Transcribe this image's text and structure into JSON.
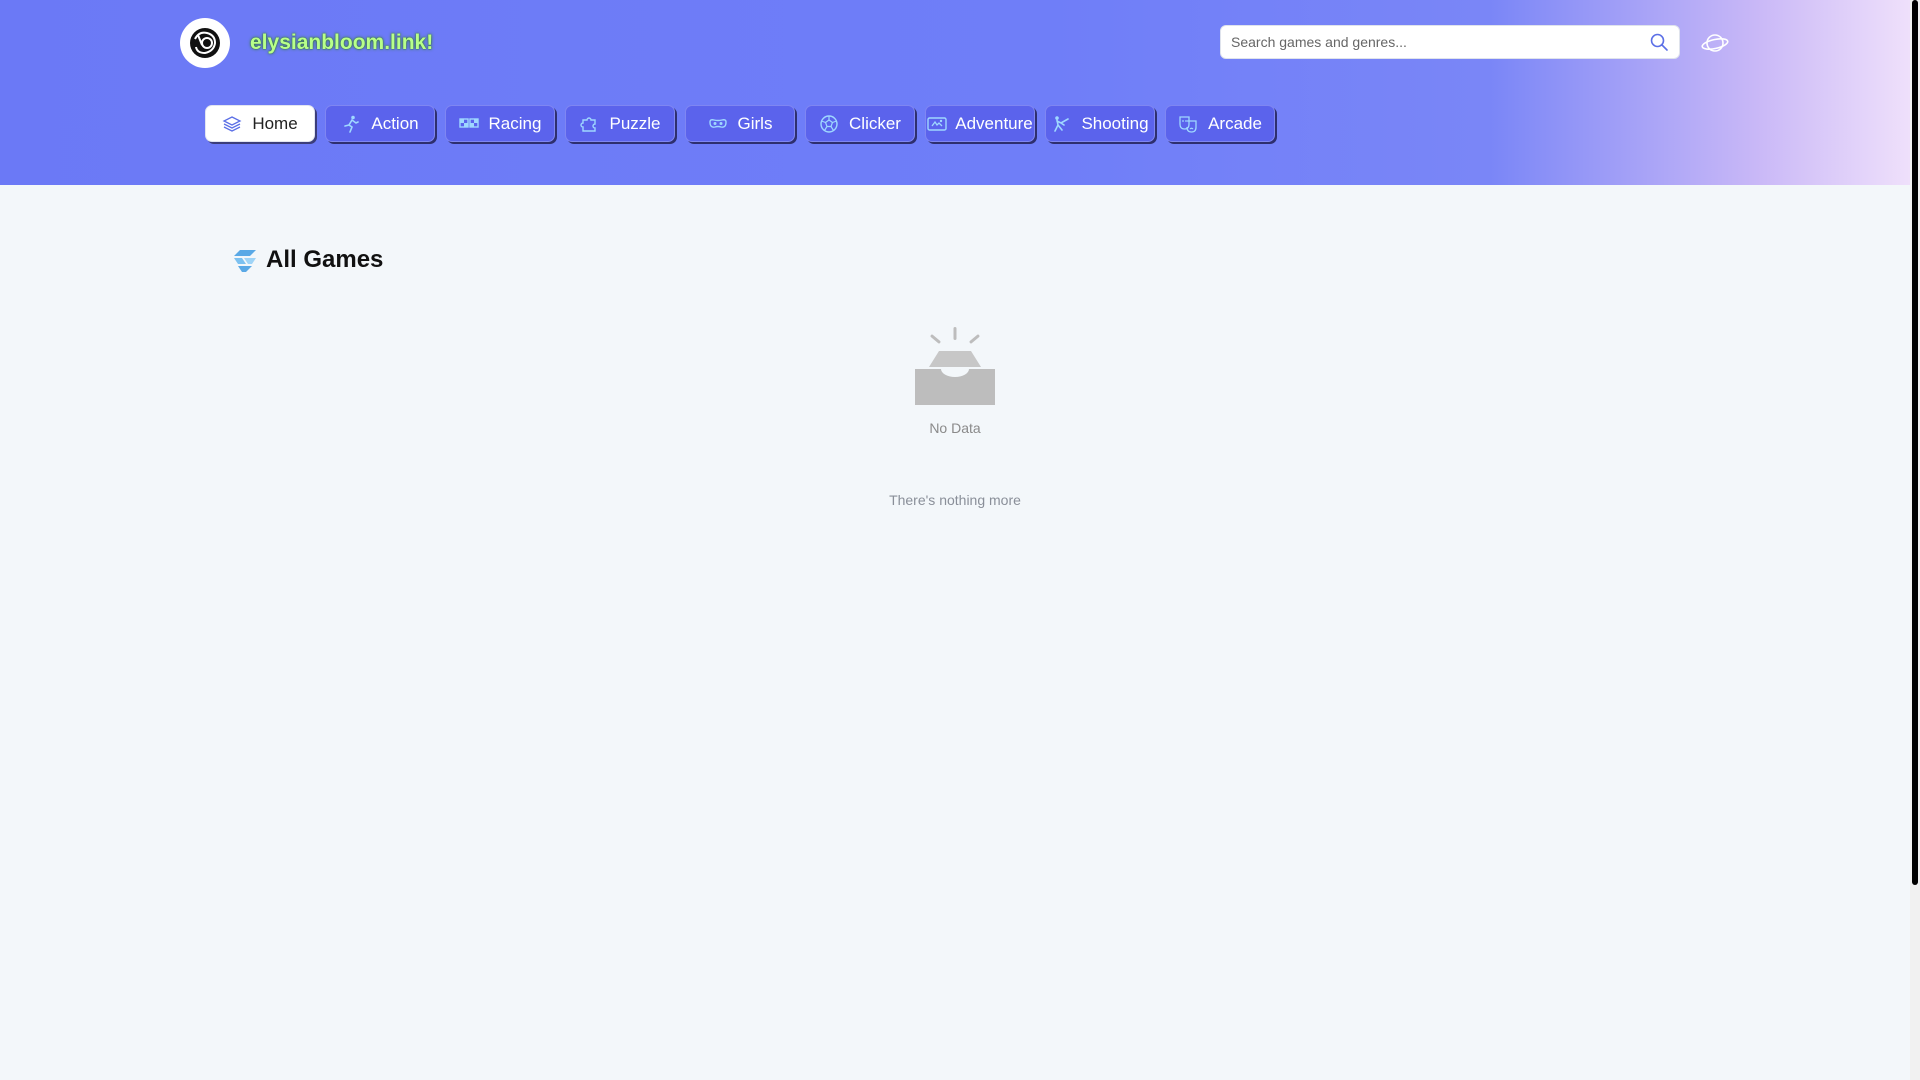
{
  "site": {
    "name": "elysianbloom.link!"
  },
  "search": {
    "placeholder": "Search games and genres..."
  },
  "nav": [
    {
      "label": "Home",
      "icon": "layers-icon"
    },
    {
      "label": "Action",
      "icon": "runner-icon"
    },
    {
      "label": "Racing",
      "icon": "race-flag-icon"
    },
    {
      "label": "Puzzle",
      "icon": "puzzle-icon"
    },
    {
      "label": "Girls",
      "icon": "mask-icon"
    },
    {
      "label": "Clicker",
      "icon": "ball-icon"
    },
    {
      "label": "Adventure",
      "icon": "ticket-icon"
    },
    {
      "label": "Shooting",
      "icon": "shooter-icon"
    },
    {
      "label": "Arcade",
      "icon": "masks-icon"
    }
  ],
  "main": {
    "title": "All Games",
    "empty_text": "No Data",
    "end_text": "There's nothing more"
  },
  "colors": {
    "nav_bg": "#5b63ec",
    "header_start": "#6b79f6",
    "header_end": "#efe0fb",
    "site_name": "#b8ff8a"
  }
}
